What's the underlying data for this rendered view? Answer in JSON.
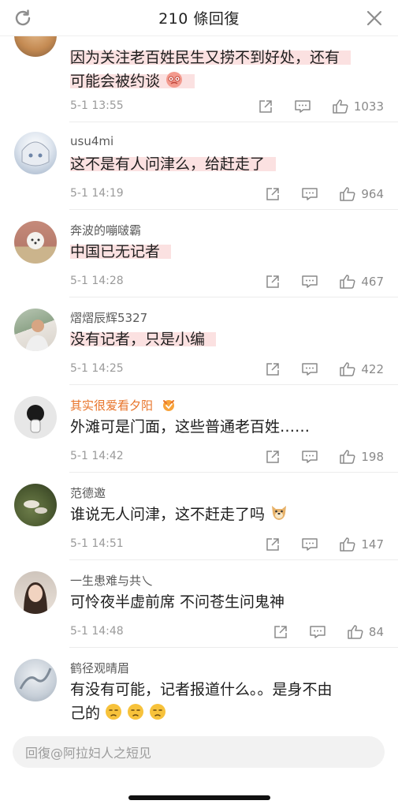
{
  "header": {
    "title": "210 條回復",
    "left_icon": "refresh-icon",
    "right_icon": "close-icon"
  },
  "comments": [
    {
      "username": "",
      "text_lines": [
        "因为关注老百姓民生又捞不到好处，还有",
        "可能会被约谈"
      ],
      "trailing_emoji": "angry-face-emoji",
      "time": "5-1 13:55",
      "likes": "1033"
    },
    {
      "username": "usu4mi",
      "text_lines": [
        "这不是有人问津么，给赶走了"
      ],
      "time": "5-1 14:19",
      "likes": "964"
    },
    {
      "username": "奔波的嘣啵霸",
      "text_lines": [
        "中国已无记者"
      ],
      "time": "5-1 14:28",
      "likes": "467"
    },
    {
      "username": "熠熠辰辉5327",
      "text_lines": [
        "没有记者，只是小编"
      ],
      "time": "5-1 14:25",
      "likes": "422"
    },
    {
      "username": "其实很爱看夕阳",
      "username_badge": "vip-badge-icon",
      "text_lines": [
        "外滩可是门面，这些普通老百姓……"
      ],
      "time": "5-1 14:42",
      "likes": "198"
    },
    {
      "username": "范德邀",
      "text_lines": [
        "谁说无人问津，这不赶走了吗"
      ],
      "trailing_emoji": "doge-emoji",
      "time": "5-1 14:51",
      "likes": "147"
    },
    {
      "username": "一生患难与共乀",
      "text_lines": [
        "可怜夜半虚前席 不问苍生问鬼神"
      ],
      "time": "5-1 14:48",
      "likes": "84"
    },
    {
      "username": "鹤径观晴眉",
      "text_lines": [
        "有没有可能，记者报道什么。。是身不由",
        "己的"
      ],
      "trailing_emoji": "sad-face-emoji x3",
      "time": "",
      "likes": ""
    }
  ],
  "actions": {
    "share_icon": "share-icon",
    "comment_icon": "comment-icon",
    "like_icon": "thumbs-up-icon"
  },
  "footer": {
    "reply_placeholder": "回復@阿拉妇人之短见"
  },
  "colors": {
    "highlight": "#fbe1e1",
    "vip_username": "#e8742a",
    "meta": "#9a9a9a"
  }
}
